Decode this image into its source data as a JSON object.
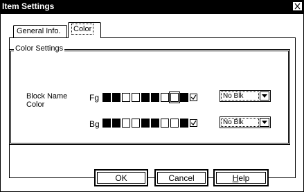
{
  "window": {
    "title": "Item Settings"
  },
  "tabs": [
    {
      "label": "General Info."
    },
    {
      "label": "Color",
      "active": true
    }
  ],
  "group": {
    "title": "Color Settings",
    "block_label_line1": "Block Name",
    "block_label_line2": "Color"
  },
  "fg": {
    "label": "Fg",
    "swatches": [
      "black",
      "black",
      "white",
      "white",
      "black",
      "black",
      "white",
      "white-selected",
      "black"
    ],
    "blink_value": "No Blk"
  },
  "bg": {
    "label": "Bg",
    "swatches": [
      "black",
      "black",
      "white",
      "white",
      "black",
      "black",
      "white",
      "white",
      "black"
    ],
    "blink_value": "No Blk"
  },
  "buttons": {
    "ok": "OK",
    "cancel": "Cancel",
    "help": "Help"
  }
}
